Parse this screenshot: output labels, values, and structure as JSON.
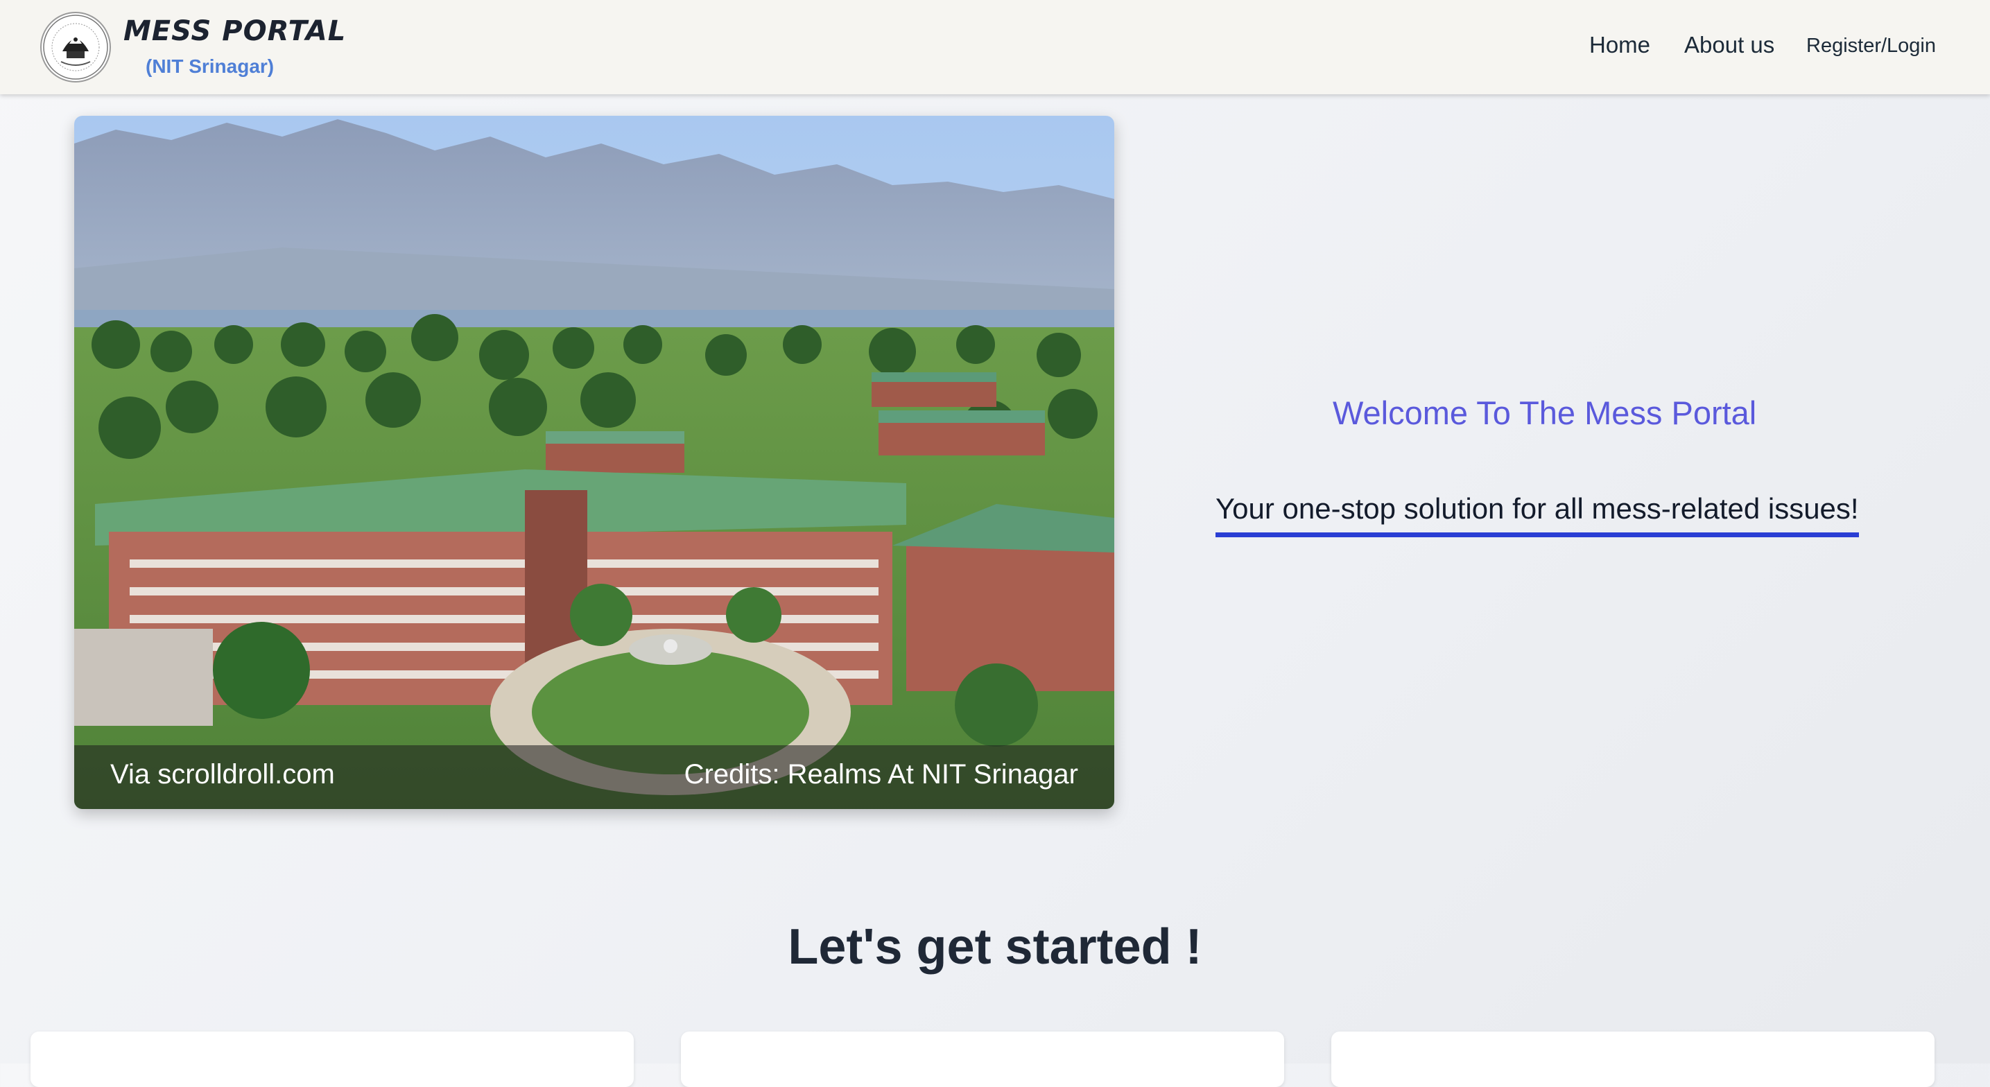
{
  "header": {
    "brand_title": "MESS PORTAL",
    "brand_subtitle": "(NIT Srinagar)",
    "logo_icon": "institute-emblem-icon",
    "nav": {
      "home": "Home",
      "about": "About us",
      "login": "Register/Login"
    }
  },
  "hero": {
    "caption_left": "Via scrolldroll.com",
    "caption_right": "Credits: Realms At NIT Srinagar"
  },
  "welcome": {
    "title": "Welcome To The Mess Portal",
    "tagline": "Your one-stop solution for all mess-related issues!"
  },
  "section": {
    "heading": "Let's get started !"
  },
  "colors": {
    "accent": "#5a59dc",
    "underline": "#2a3ed4",
    "subtitle_blue": "#4f7fd6",
    "header_bg": "#f6f5f1"
  }
}
